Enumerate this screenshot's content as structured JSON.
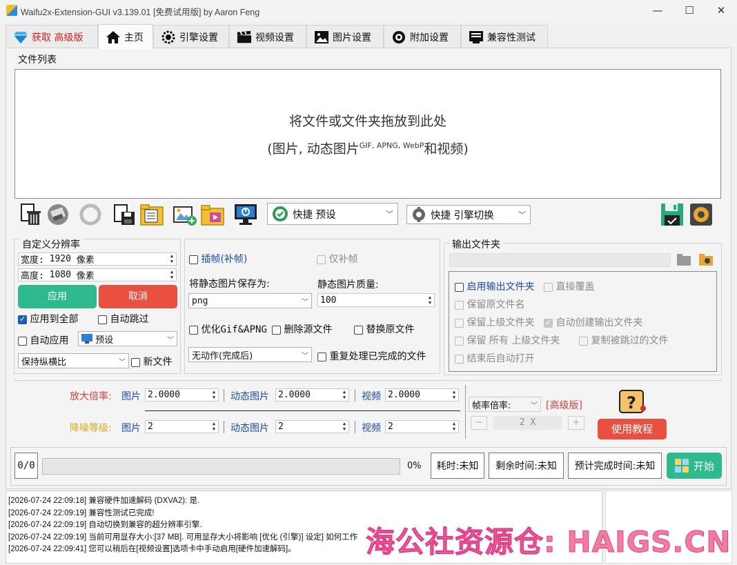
{
  "window": {
    "title": "Waifu2x-Extension-GUI v3.139.01 [免费试用版] by Aaron Feng",
    "minimize": "—",
    "maximize": "☐",
    "close": "✕"
  },
  "tabs": [
    {
      "label": "获取 高级版",
      "icon": "diamond-icon"
    },
    {
      "label": "主页",
      "icon": "home-icon"
    },
    {
      "label": "引擎设置",
      "icon": "engine-gear-icon"
    },
    {
      "label": "视频设置",
      "icon": "clapperboard-icon"
    },
    {
      "label": "图片设置",
      "icon": "picture-icon"
    },
    {
      "label": "附加设置",
      "icon": "gear-icon"
    },
    {
      "label": "兼容性测试",
      "icon": "test-list-icon"
    }
  ],
  "file_list": {
    "group_label": "文件列表",
    "drop_line1": "将文件或文件夹拖放到此处",
    "drop_line2_prefix": "(图片, 动态图片",
    "drop_line2_sup": "GIF, APNG, WebP",
    "drop_line2_suffix": "和视频)"
  },
  "toolbar": {
    "preset_combo": "快捷 预设",
    "engine_combo": "快捷 引擎切换"
  },
  "custom_res": {
    "group_label": "自定义分辨率",
    "width_label": "宽度:",
    "width_value": "1920",
    "width_unit": "像素",
    "height_label": "高度:",
    "height_value": "1080",
    "height_unit": "像素",
    "apply_button": "应用",
    "cancel_button": "取消",
    "apply_all": "应用到全部",
    "auto_skip": "自动跳过",
    "auto_apply": "自动应用",
    "preset_select": "预设",
    "aspect_select": "保持纵横比",
    "new_file": "新文件"
  },
  "middle": {
    "interpolate": "插帧(补帧)",
    "interpolate_only": "仅补帧",
    "save_static_label": "将静态图片保存为:",
    "static_quality_label": "静态图片质量:",
    "format_value": "png",
    "quality_value": "100",
    "optimize_gif": "优化Gif&APNG",
    "delete_source": "删除源文件",
    "replace_source": "替换原文件",
    "after_action": "无动作(完成后)",
    "reprocess": "重复处理已完成的文件"
  },
  "output": {
    "group_label": "输出文件夹",
    "path_value": "",
    "enable_output": "启用输出文件夹",
    "direct_overwrite": "直接覆盖",
    "keep_filename": "保留原文件名",
    "keep_parent": "保留上级文件夹",
    "auto_create": "自动创建输出文件夹",
    "keep_all_parents": "保留 所有 上级文件夹",
    "copy_skipped": "复制被跳过的文件",
    "auto_open": "结束后自动打开"
  },
  "scale": {
    "scale_label": "放大倍率:",
    "denoise_label": "降噪等级:",
    "image_label": "图片",
    "anim_label": "动态图片",
    "video_label": "视频",
    "scale_image": "2.0000",
    "scale_anim": "2.0000",
    "scale_video": "2.0000",
    "denoise_image": "2",
    "denoise_anim": "2",
    "denoise_video": "2",
    "frame_rate_label": "帧率倍率:",
    "premium_tag": "[高级版]",
    "minus": "−",
    "frame_value": "2 X",
    "plus": "+",
    "tutorial_button": "使用教程"
  },
  "progress": {
    "count": "0/0",
    "percent": "0%",
    "percent_value": 0,
    "elapsed": "耗时:未知",
    "remaining": "剩余时间:未知",
    "eta": "预计完成时间:未知",
    "start_button": "开始"
  },
  "log": [
    "[2026-07-24 22:09:18] 兼容硬件加速解码 (DXVA2): 是.",
    "[2026-07-24 22:09:19] 兼容性测试已完成!",
    "[2026-07-24 22:09:19] 自动切换到兼容的超分辨率引擎.",
    "[2026-07-24 22:09:19] 当前可用显存大小:[37 MB]. 可用显存大小将影响 [优化 (引擎)] 设定] 如何工作",
    "[2026-07-24 22:09:41] 您可以稍后在[视频设置]选项卡中手动启用[硬件加速解码]。"
  ],
  "watermark": "海公社资源仓: HAIGS.CN",
  "colors": {
    "green": "#2fb98f",
    "red": "#e8513f",
    "blue_text": "#1d49a8",
    "watermark": "#f07ca0"
  }
}
